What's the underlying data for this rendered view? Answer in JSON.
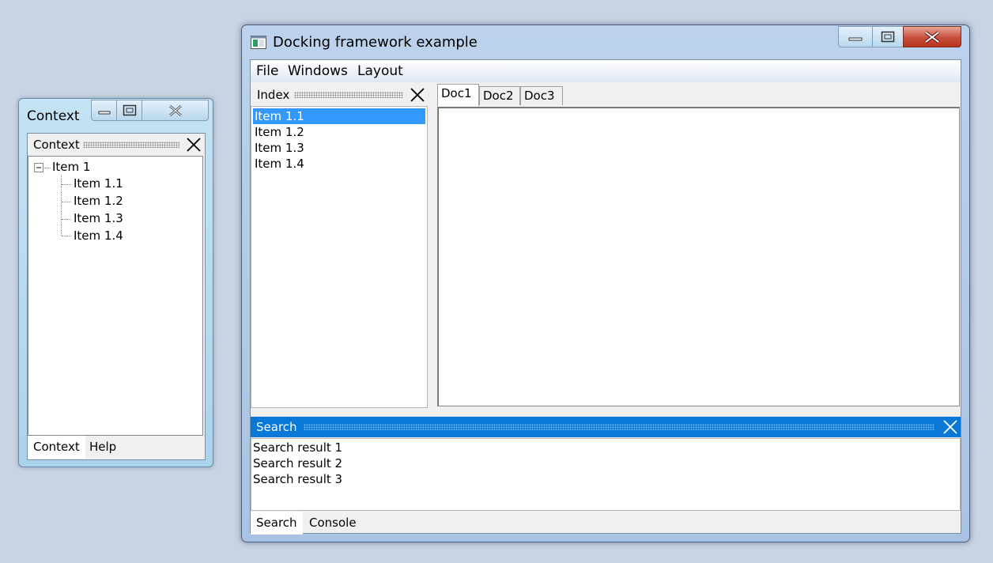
{
  "context_window": {
    "title": "Context",
    "dock_title": "Context",
    "tree": {
      "root": "Item 1",
      "children": [
        "Item 1.1",
        "Item 1.2",
        "Item 1.3",
        "Item 1.4"
      ]
    },
    "tabs": [
      "Context",
      "Help"
    ],
    "active_tab": "Context"
  },
  "main_window": {
    "title": "Docking framework example",
    "menu": [
      "File",
      "Windows",
      "Layout"
    ],
    "index_panel": {
      "title": "Index",
      "items": [
        "Item 1.1",
        "Item 1.2",
        "Item 1.3",
        "Item 1.4"
      ],
      "selected": "Item 1.1"
    },
    "doc_tabs": [
      "Doc1",
      "Doc2",
      "Doc3"
    ],
    "active_doc_tab": "Doc1",
    "search_panel": {
      "title": "Search",
      "results": [
        "Search result 1",
        "Search result 2",
        "Search result 3"
      ]
    },
    "bottom_tabs": [
      "Search",
      "Console"
    ],
    "active_bottom_tab": "Search"
  },
  "colors": {
    "selection": "#3399ff",
    "active_panel_header": "#0a78d7",
    "close_button": "#c74f3c",
    "desktop": "#c8d3e3"
  },
  "icons": [
    "minimize-icon",
    "maximize-icon",
    "close-icon",
    "app-icon",
    "tree-collapse-icon"
  ]
}
